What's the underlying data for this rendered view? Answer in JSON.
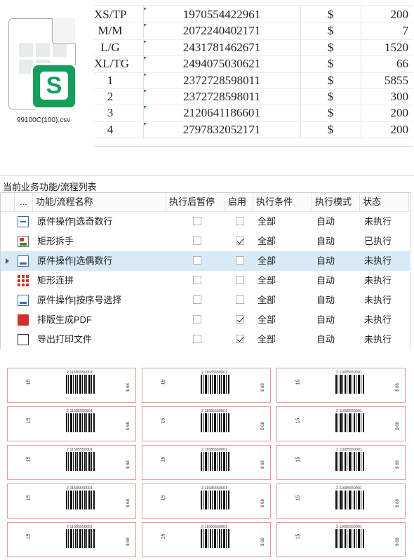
{
  "file": {
    "name": "99100C(100).csv",
    "icon": "spreadsheet-file-icon",
    "badge_letter": "S",
    "badge_color": "#169e5d"
  },
  "csv": {
    "rows": [
      {
        "code": "XS/TP",
        "number": "1970554422961",
        "currency": "$",
        "qty": "200"
      },
      {
        "code": "M/M",
        "number": "2072240402171",
        "currency": "$",
        "qty": "7"
      },
      {
        "code": "L/G",
        "number": "2431781462671",
        "currency": "$",
        "qty": "1520"
      },
      {
        "code": "XL/TG",
        "number": "2494075030621",
        "currency": "$",
        "qty": "66"
      },
      {
        "code": "1",
        "number": "2372728598011",
        "currency": "$",
        "qty": "5855"
      },
      {
        "code": "2",
        "number": "2372728598011",
        "currency": "$",
        "qty": "300"
      },
      {
        "code": "3",
        "number": "2120641186601",
        "currency": "$",
        "qty": "200"
      },
      {
        "code": "4",
        "number": "2797832052171",
        "currency": "$",
        "qty": "200"
      }
    ]
  },
  "panel": {
    "title": "当前业务功能/流程列表",
    "headers": {
      "more": "...",
      "name": "功能/流程名称",
      "pause": "执行后暂停",
      "enable": "启用",
      "condition": "执行条件",
      "mode": "执行模式",
      "status": "状态"
    },
    "rows": [
      {
        "name": "原件操作|选奇数行",
        "icon": "line-icon",
        "pause": false,
        "enabled": false,
        "condition": "全部",
        "mode": "自动",
        "status": "未执行"
      },
      {
        "name": "矩形拆手",
        "icon": "rectangle-icon",
        "pause": false,
        "enabled": true,
        "condition": "全部",
        "mode": "自动",
        "status": "已执行"
      },
      {
        "name": "原件操作|选偶数行",
        "icon": "even-row-icon",
        "pause": false,
        "enabled": false,
        "condition": "全部",
        "mode": "自动",
        "status": "未执行",
        "selected": true
      },
      {
        "name": "矩形连拼",
        "icon": "grid-icon",
        "pause": false,
        "enabled": false,
        "condition": "全部",
        "mode": "自动",
        "status": "未执行"
      },
      {
        "name": "原件操作|按序号选择",
        "icon": "sequence-icon",
        "pause": false,
        "enabled": false,
        "condition": "全部",
        "mode": "自动",
        "status": "未执行"
      },
      {
        "name": "排版生成PDF",
        "icon": "pdf-icon",
        "pause": false,
        "enabled": true,
        "condition": "全部",
        "mode": "自动",
        "status": "未执行"
      },
      {
        "name": "导出打印文件",
        "icon": "print-pdf-icon",
        "pause": false,
        "enabled": true,
        "condition": "全部",
        "mode": "自动",
        "status": "未执行"
      }
    ],
    "selection_color": "#d9eaf7"
  },
  "labels": {
    "left_text": "15",
    "right_text": "$ 68",
    "code_text": "2 11685550001",
    "border_color": "#e59a9a",
    "count": 15
  }
}
